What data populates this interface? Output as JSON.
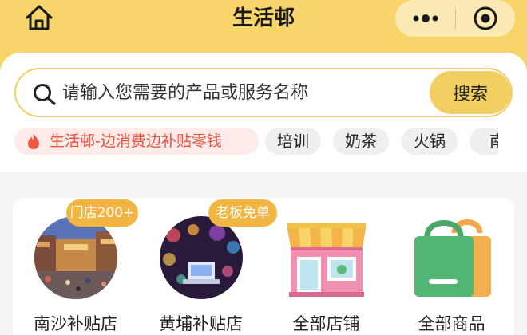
{
  "header": {
    "title": "生活邨",
    "home_icon": "home-icon",
    "more_icon": "more-dots-icon",
    "close_icon": "target-close-icon",
    "bg_color": "#f7d56b"
  },
  "search": {
    "placeholder": "请输入您需要的产品或服务名称",
    "button_label": "搜索",
    "icon": "search-icon",
    "accent_color": "#f2cf62"
  },
  "tags": {
    "promo_label": "生活邨-边消费边补贴零钱",
    "promo_icon": "flame-icon",
    "promo_color": "#e8523e",
    "items": [
      "培训",
      "奶茶",
      "火锅",
      "南"
    ]
  },
  "categories": [
    {
      "label": "南沙补贴店",
      "badge": "门店200+"
    },
    {
      "label": "黄埔补贴店",
      "badge": "老板免单"
    },
    {
      "label": "全部店铺"
    },
    {
      "label": "全部商品"
    }
  ]
}
